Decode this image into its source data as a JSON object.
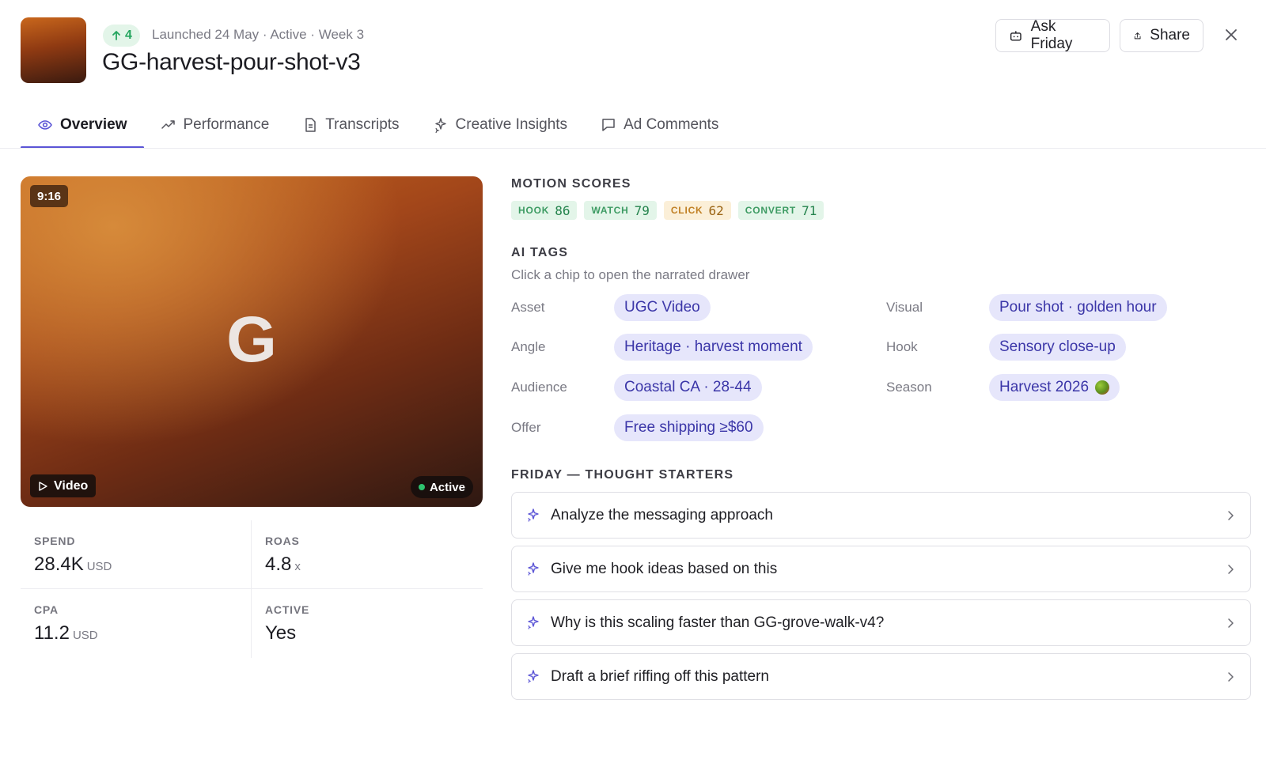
{
  "header": {
    "rank_delta": "4",
    "meta": "Launched 24 May · Active · Week 3",
    "title": "GG-harvest-pour-shot-v3",
    "ask_label": "Ask Friday",
    "share_label": "Share"
  },
  "tabs": [
    {
      "label": "Overview",
      "icon": "eye-icon",
      "active": true
    },
    {
      "label": "Performance",
      "icon": "trend-icon"
    },
    {
      "label": "Transcripts",
      "icon": "document-icon"
    },
    {
      "label": "Creative Insights",
      "icon": "sparkle-icon"
    },
    {
      "label": "Ad Comments",
      "icon": "comment-icon"
    }
  ],
  "video": {
    "aspect": "9:16",
    "letter": "G",
    "type_label": "Video",
    "status_label": "Active"
  },
  "metrics": [
    {
      "label": "SPEND",
      "value": "28.4K",
      "unit": "USD"
    },
    {
      "label": "ROAS",
      "value": "4.8",
      "unit": "x"
    },
    {
      "label": "CPA",
      "value": "11.2",
      "unit": "USD"
    },
    {
      "label": "ACTIVE",
      "value": "Yes",
      "unit": ""
    }
  ],
  "motion": {
    "label": "MOTION SCORES",
    "scores": [
      {
        "name": "HOOK",
        "value": "86",
        "tone": "green"
      },
      {
        "name": "WATCH",
        "value": "79",
        "tone": "green"
      },
      {
        "name": "CLICK",
        "value": "62",
        "tone": "amber"
      },
      {
        "name": "CONVERT",
        "value": "71",
        "tone": "green"
      }
    ]
  },
  "ai_tags": {
    "label": "AI TAGS",
    "subtitle": "Click a chip to open the narrated drawer",
    "left": [
      {
        "label": "Asset",
        "chip": "UGC Video"
      },
      {
        "label": "Angle",
        "chip": "Heritage · harvest moment"
      },
      {
        "label": "Audience",
        "chip": "Coastal CA · 28-44"
      },
      {
        "label": "Offer",
        "chip": "Free shipping ≥$60"
      }
    ],
    "right": [
      {
        "label": "Visual",
        "chip": "Pour shot · golden hour"
      },
      {
        "label": "Hook",
        "chip": "Sensory close-up"
      },
      {
        "label": "Season",
        "chip": "Harvest 2026",
        "emoji": "olive-icon"
      }
    ]
  },
  "starters": {
    "label": "FRIDAY — THOUGHT STARTERS",
    "items": [
      "Analyze the messaging approach",
      "Give me hook ideas based on this",
      "Why is this scaling faster than GG-grove-walk-v4?",
      "Draft a brief riffing off this pattern"
    ]
  },
  "colors": {
    "accent": "#5b55d6",
    "chip_bg": "#e6e6fb",
    "chip_text": "#3b36a8",
    "green": "#25a55f",
    "amber": "#c07f23"
  }
}
